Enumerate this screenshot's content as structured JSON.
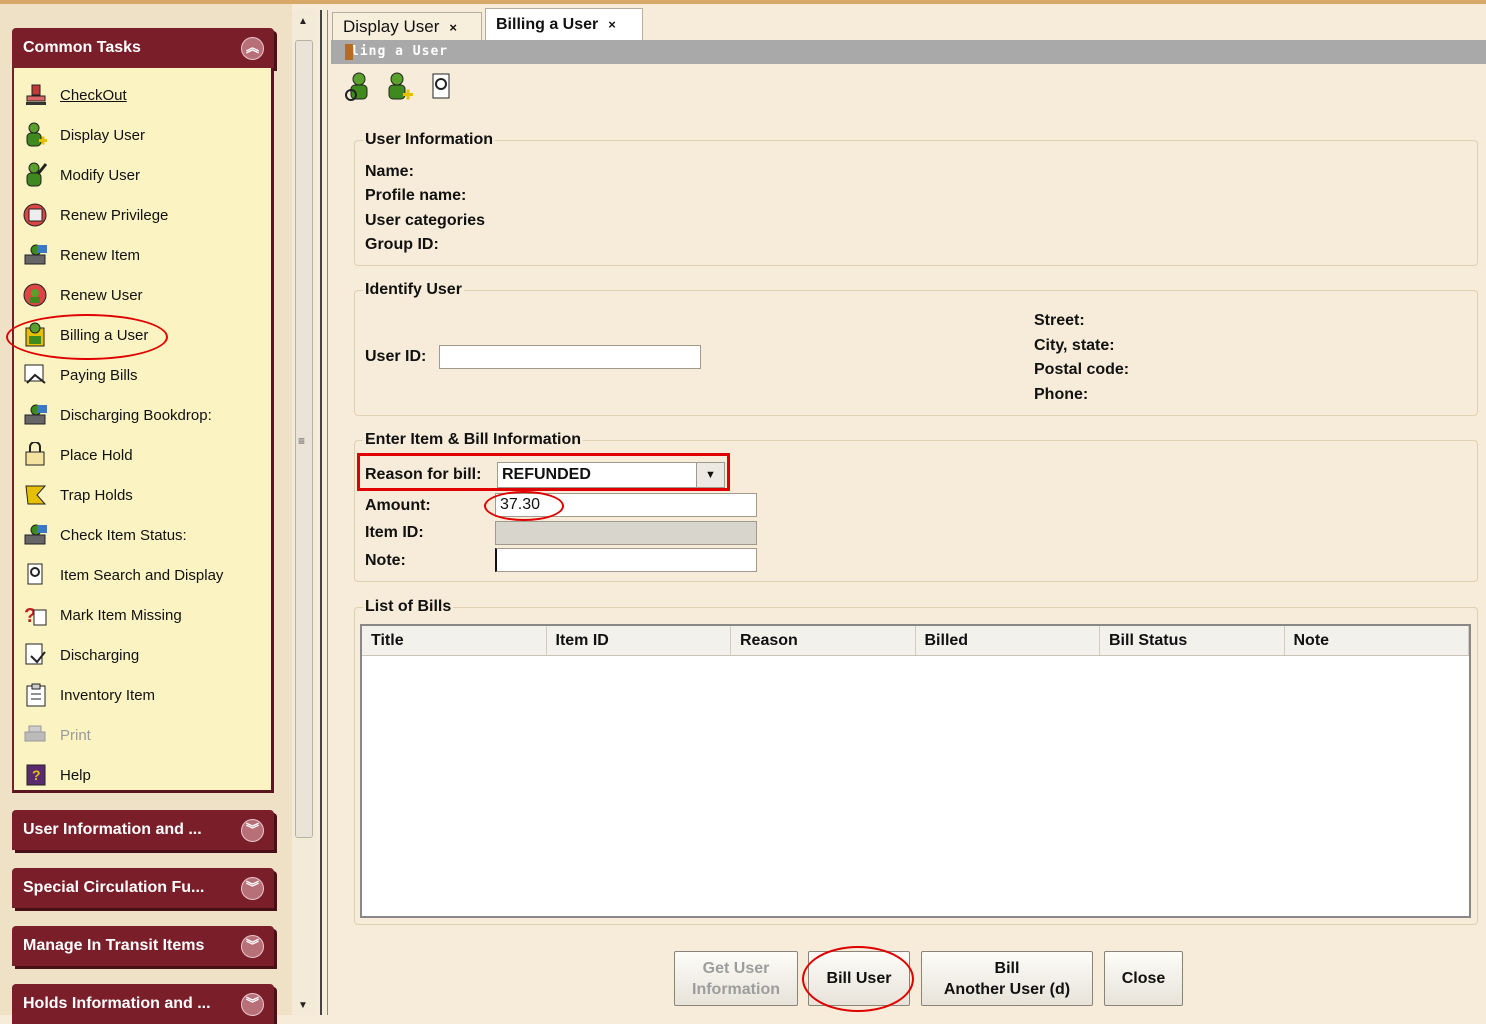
{
  "sidebar": {
    "common_tasks_title": "Common Tasks",
    "tasks": [
      {
        "label": "CheckOut",
        "icon": "stamp-icon"
      },
      {
        "label": "Display User",
        "icon": "user-plus-icon"
      },
      {
        "label": "Modify User",
        "icon": "user-edit-icon"
      },
      {
        "label": "Renew Privilege",
        "icon": "renew-privilege-icon"
      },
      {
        "label": "Renew Item",
        "icon": "renew-item-icon"
      },
      {
        "label": "Renew User",
        "icon": "renew-user-icon"
      },
      {
        "label": "Billing a User",
        "icon": "billing-icon"
      },
      {
        "label": "Paying Bills",
        "icon": "paying-bills-icon"
      },
      {
        "label": "Discharging Bookdrop:",
        "icon": "bookdrop-icon"
      },
      {
        "label": "Place Hold",
        "icon": "place-hold-icon"
      },
      {
        "label": "Trap Holds",
        "icon": "trap-holds-icon"
      },
      {
        "label": "Check Item Status:",
        "icon": "item-status-icon"
      },
      {
        "label": "Item Search and Display",
        "icon": "item-search-icon"
      },
      {
        "label": "Mark Item Missing",
        "icon": "item-missing-icon"
      },
      {
        "label": "Discharging",
        "icon": "discharging-icon"
      },
      {
        "label": "Inventory Item",
        "icon": "inventory-icon"
      },
      {
        "label": "Print",
        "icon": "printer-icon"
      },
      {
        "label": "Help",
        "icon": "help-icon"
      }
    ],
    "panels": [
      "User Information and ...",
      "Special Circulation Fu...",
      "Manage In Transit Items",
      "Holds Information and ..."
    ]
  },
  "tabs": [
    {
      "label": "Display User",
      "close": "×"
    },
    {
      "label": "Billing a User",
      "close": "×"
    }
  ],
  "window_title": "ling a User",
  "user_info": {
    "legend": "User Information",
    "name_label": "Name:",
    "profile_label": "Profile name:",
    "categories_label": "User categories",
    "group_label": "Group ID:"
  },
  "identify": {
    "legend": "Identify User",
    "user_id_label": "User ID:",
    "user_id_value": "",
    "street_label": "Street:",
    "city_label": "City, state:",
    "postal_label": "Postal code:",
    "phone_label": "Phone:"
  },
  "bill": {
    "legend": "Enter Item & Bill Information",
    "reason_label": "Reason for bill:",
    "reason_value": "REFUNDED",
    "amount_label": "Amount:",
    "amount_value": "37.30",
    "item_id_label": "Item ID:",
    "item_id_value": "",
    "note_label": "Note:",
    "note_value": ""
  },
  "bills_list": {
    "legend": "List of Bills",
    "columns": [
      "Title",
      "Item ID",
      "Reason",
      "Billed",
      "Bill Status",
      "Note"
    ]
  },
  "buttons": {
    "get_info_line1": "Get User",
    "get_info_line2": "Information",
    "bill_user": "Bill User",
    "bill_another_line1": "Bill",
    "bill_another_line2": "Another User (d)",
    "close": "Close"
  },
  "colors": {
    "accent": "#7a1f2a",
    "annotation": "#e00000"
  }
}
